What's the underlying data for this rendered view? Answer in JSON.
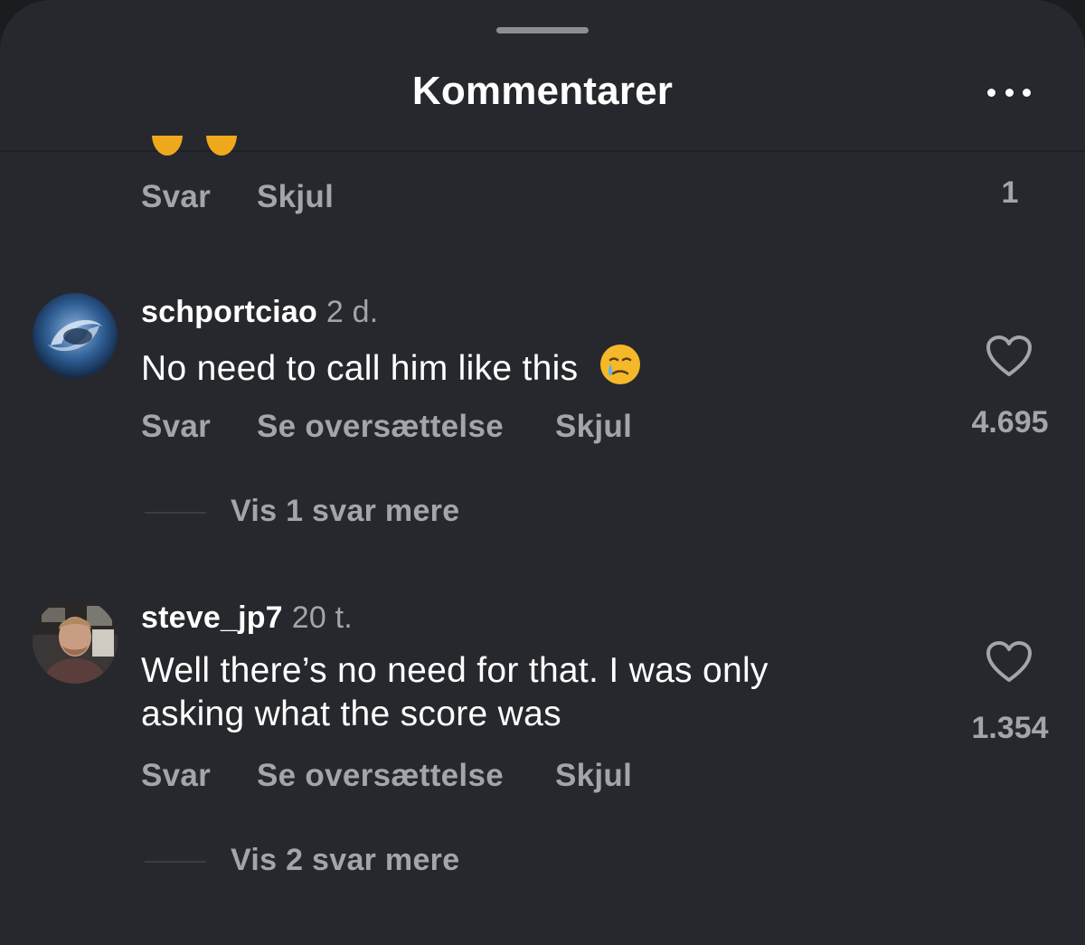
{
  "header": {
    "title": "Kommentarer",
    "more_icon": "more-horizontal-icon"
  },
  "partial_comment": {
    "reply_label": "Svar",
    "hide_label": "Skjul",
    "like_count": "1"
  },
  "comments": [
    {
      "username": "schportciao",
      "time": "2 d.",
      "text": "No need to call him like this",
      "emoji": "crying-face-emoji",
      "reply_label": "Svar",
      "translate_label": "Se oversættelse",
      "hide_label": "Skjul",
      "like_count": "4.695",
      "view_replies": "Vis 1 svar mere"
    },
    {
      "username": "steve_jp7",
      "time": "20 t.",
      "text_line1": "Well there’s no need for that. I was only",
      "text_line2": "asking what the score was",
      "reply_label": "Svar",
      "translate_label": "Se oversættelse",
      "hide_label": "Skjul",
      "like_count": "1.354",
      "view_replies": "Vis 2 svar mere"
    }
  ],
  "colors": {
    "background": "#26282d",
    "primary_text": "#ffffff",
    "secondary_text": "#a3a5ab"
  }
}
